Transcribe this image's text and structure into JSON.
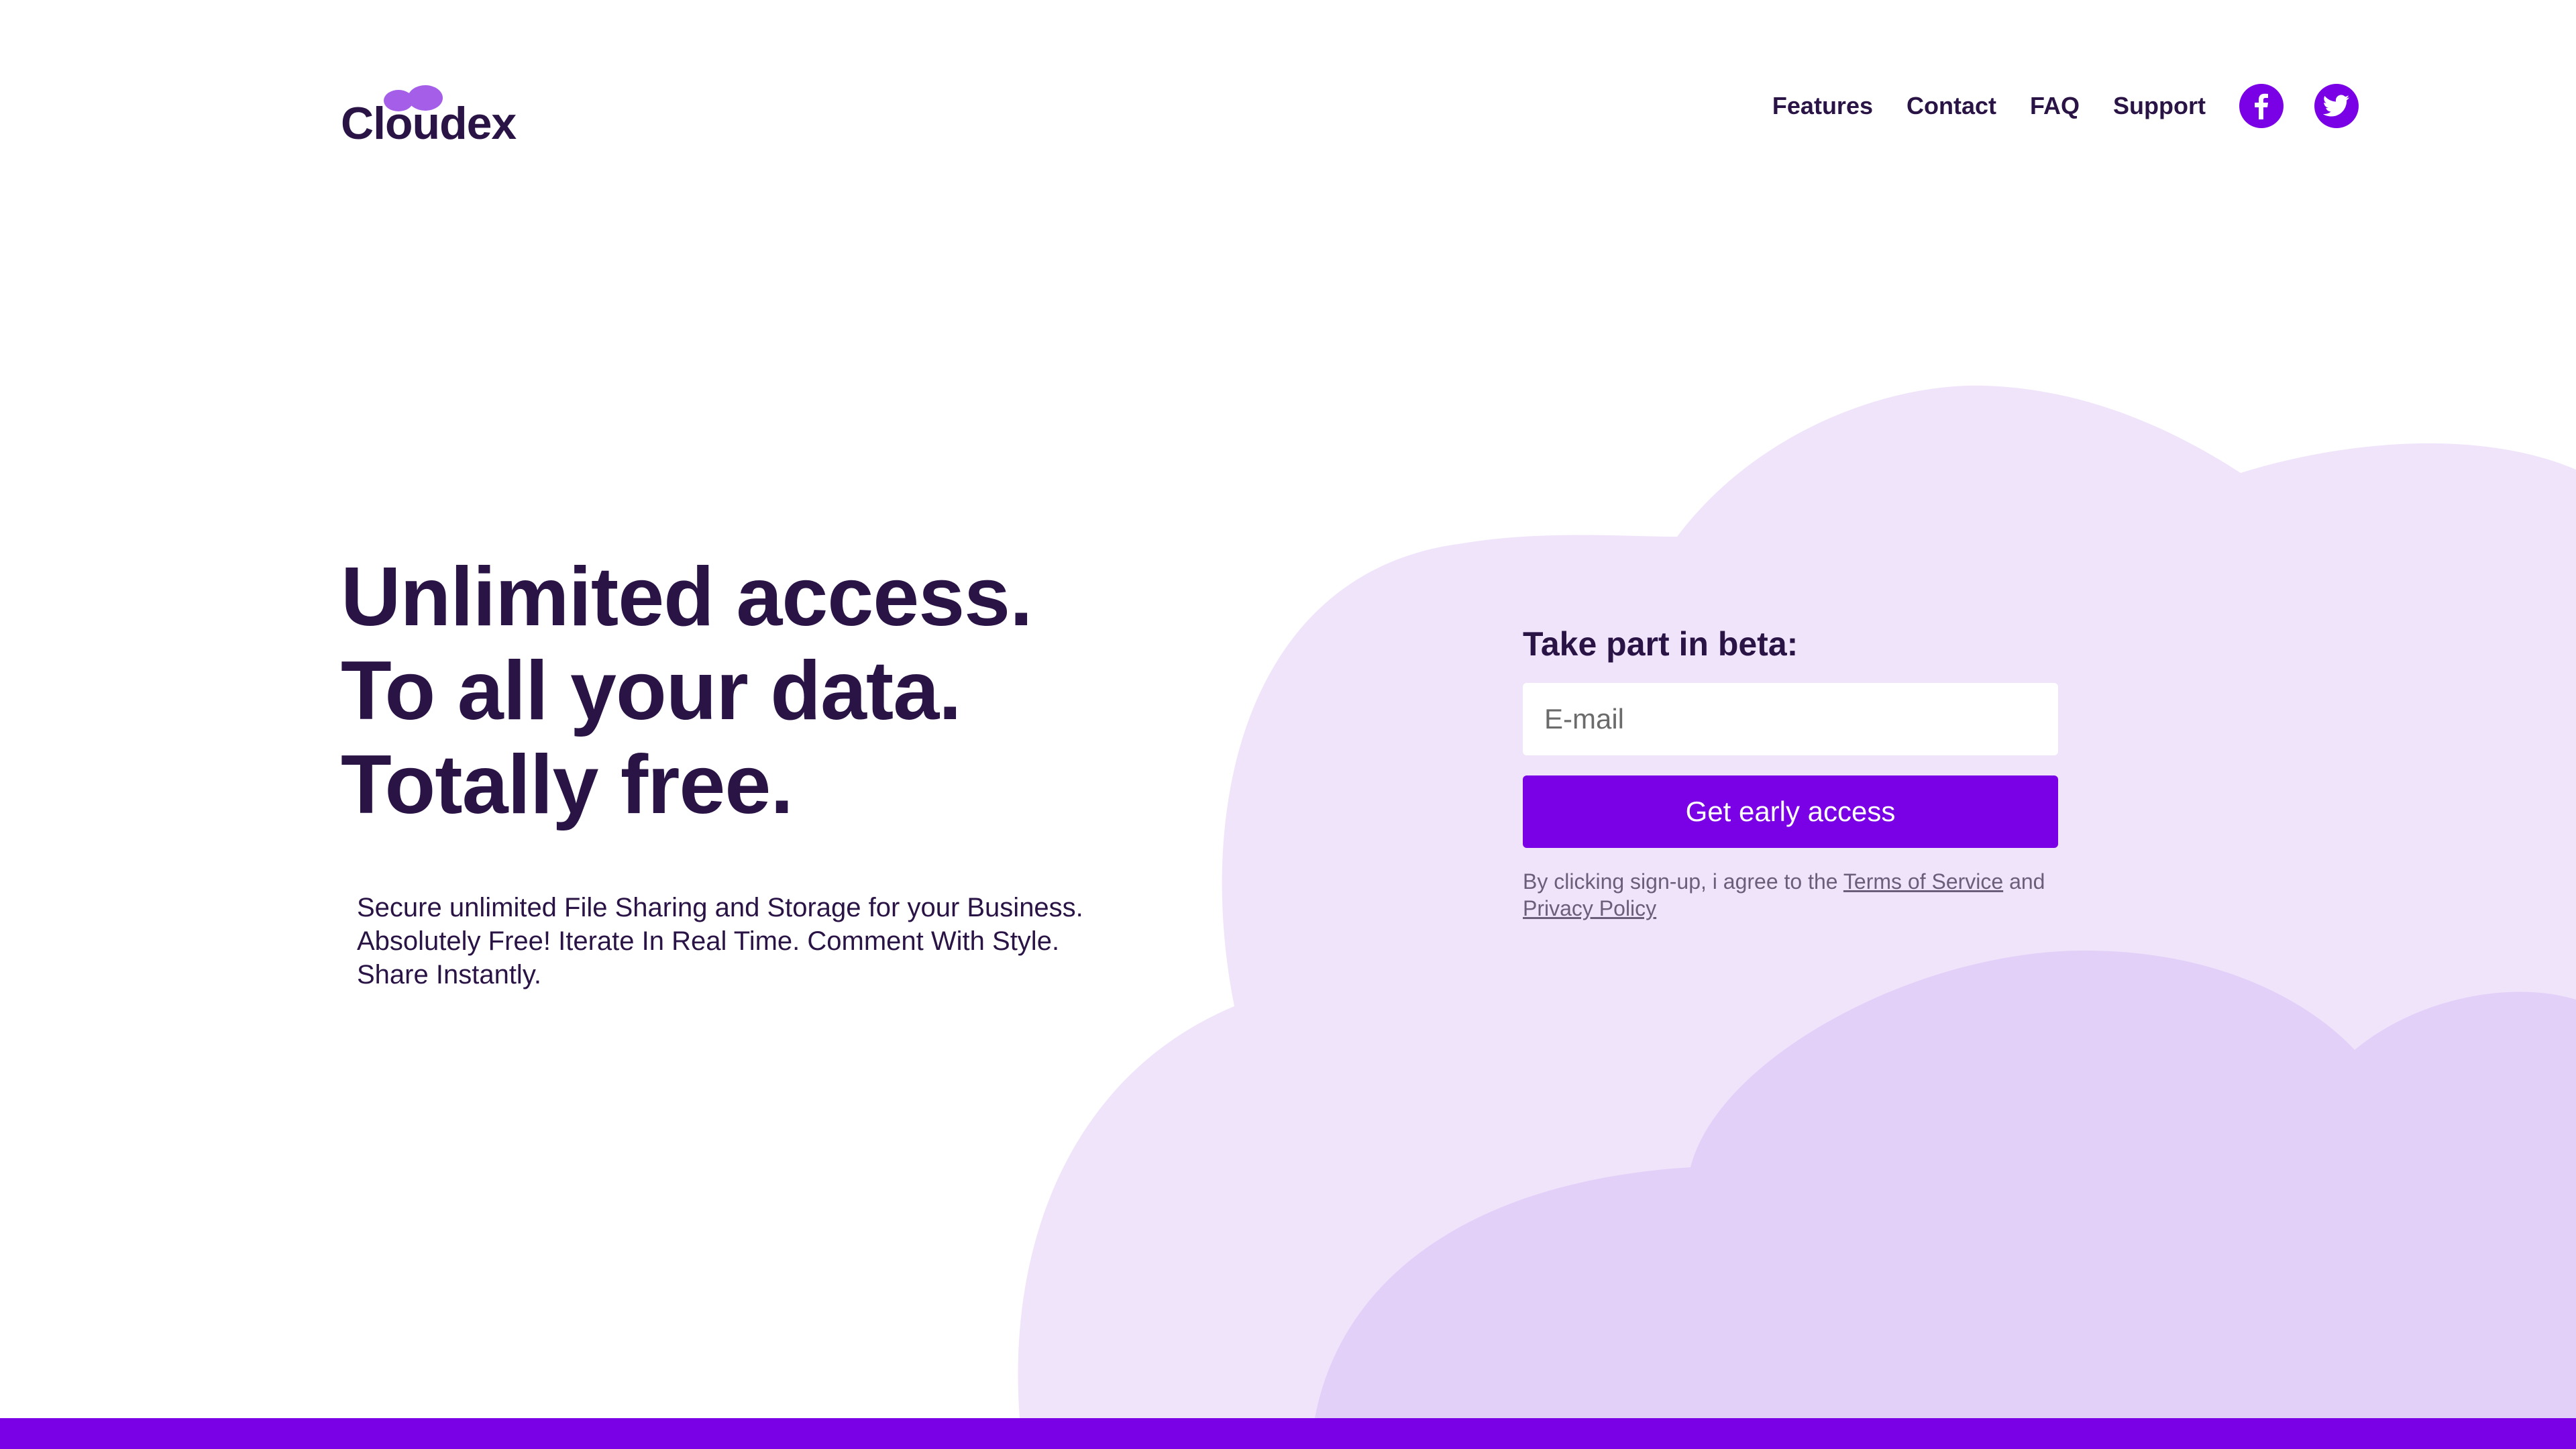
{
  "brand": {
    "name": "Cloudex",
    "accent_color": "#7a00e6",
    "logo_mark_color": "#a55ee8",
    "text_color": "#2a1446"
  },
  "nav": {
    "links": [
      "Features",
      "Contact",
      "FAQ",
      "Support"
    ],
    "social": [
      {
        "icon": "facebook-icon"
      },
      {
        "icon": "twitter-icon"
      }
    ]
  },
  "hero": {
    "headline": [
      "Unlimited access.",
      "To all your data.",
      "Totally free."
    ],
    "description": [
      "Secure unlimited File Sharing and Storage for your Business.",
      "Absolutely Free! Iterate In Real Time. Comment With Style.",
      "Share Instantly."
    ]
  },
  "beta": {
    "title": "Take part in beta:",
    "email_placeholder": "E-mail",
    "email_value": "",
    "button_label": "Get early access",
    "legal_prefix": "By clicking sign-up, i agree to the",
    "terms_label": "Terms of Service",
    "legal_and": "and",
    "privacy_label": "Privacy Policy"
  },
  "decor": {
    "cloud_light": "#f0e4fb",
    "cloud_mid": "#e3d0f8",
    "bottom_bar_color": "#7a00e6"
  }
}
